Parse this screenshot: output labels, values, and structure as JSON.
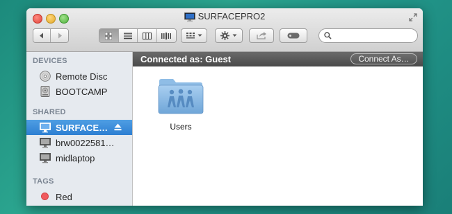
{
  "window": {
    "title": "SURFACEPRO2"
  },
  "sidebar": {
    "sections": [
      {
        "heading": "DEVICES",
        "items": [
          {
            "label": "Remote Disc",
            "icon": "remote-disc-icon"
          },
          {
            "label": "BOOTCAMP",
            "icon": "hard-drive-icon"
          }
        ]
      },
      {
        "heading": "SHARED",
        "items": [
          {
            "label": "SURFACE…",
            "icon": "pc-monitor-icon",
            "selected": true
          },
          {
            "label": "brw0022581…",
            "icon": "pc-monitor-icon"
          },
          {
            "label": "midlaptop",
            "icon": "pc-monitor-icon"
          }
        ]
      },
      {
        "heading": "TAGS",
        "items": [
          {
            "label": "Red",
            "icon": "red-tag-icon",
            "color": "#f05a5e"
          }
        ]
      }
    ]
  },
  "connection": {
    "status": "Connected as: Guest",
    "button": "Connect As…"
  },
  "content": {
    "items": [
      {
        "label": "Users",
        "icon": "shared-folder-icon"
      }
    ]
  },
  "colors": {
    "selection": "#3d8fdc",
    "connbar": "#555555",
    "sidebar_bg": "#e6eaef"
  }
}
